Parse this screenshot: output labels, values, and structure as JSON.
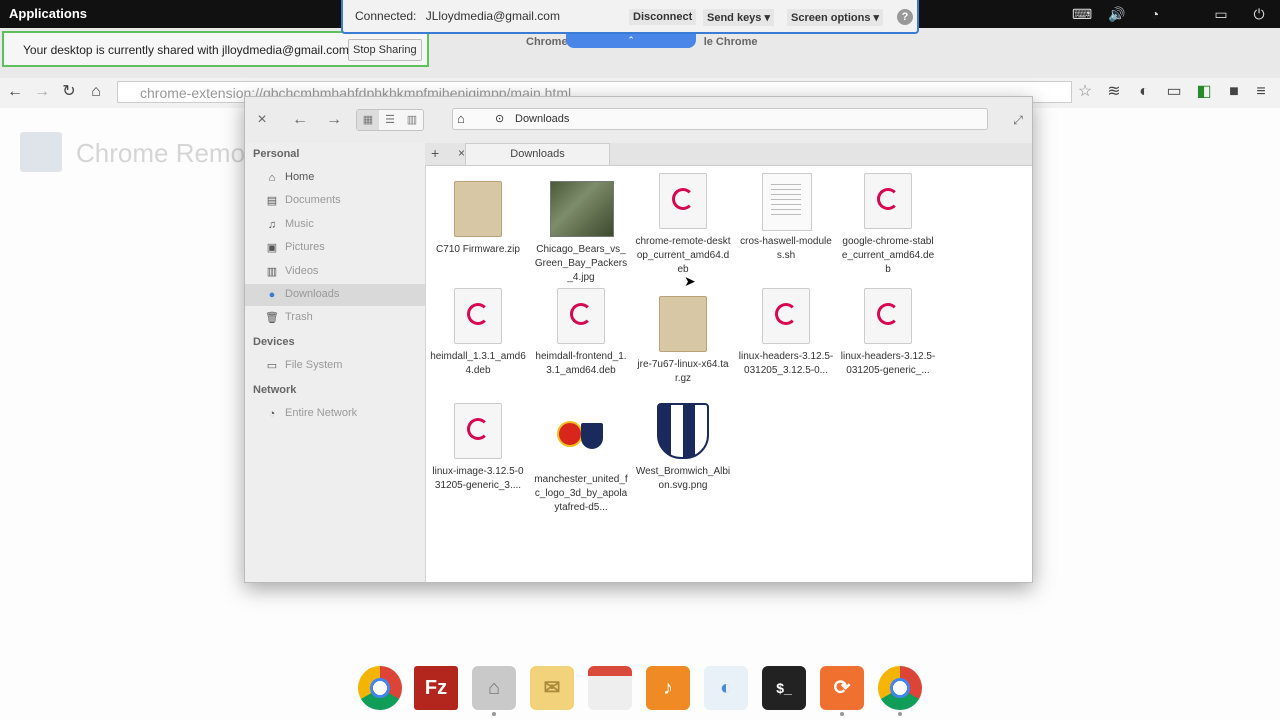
{
  "top_panel": {
    "apps_label": "Applications",
    "tray": [
      "keyboard-icon",
      "volume-icon",
      "wifi-icon",
      "battery-icon",
      "power-icon"
    ]
  },
  "remote": {
    "connected_label": "Connected:",
    "connected_email": "JLloydmedia@gmail.com",
    "disconnect": "Disconnect",
    "send_keys": "Send keys",
    "screen_options": "Screen options",
    "help": "?"
  },
  "chrome": {
    "title_left": "Chrome",
    "title_right": "le Chrome",
    "share_notice": "Your desktop is currently shared with jlloydmedia@gmail.com.",
    "stop_sharing": "Stop Sharing",
    "url": "chrome-extension://gbchcmhmhahfdphkhkmpfmihenigjmpp/main.html",
    "page_title": "Chrome Remo"
  },
  "file_manager": {
    "path": "Downloads",
    "tab": "Downloads",
    "sidebar": {
      "personal": "Personal",
      "devices": "Devices",
      "network": "Network",
      "items": [
        {
          "label": "Home",
          "icon": "home-icon"
        },
        {
          "label": "Documents",
          "icon": "documents-icon"
        },
        {
          "label": "Music",
          "icon": "music-icon"
        },
        {
          "label": "Pictures",
          "icon": "pictures-icon"
        },
        {
          "label": "Videos",
          "icon": "videos-icon"
        },
        {
          "label": "Downloads",
          "icon": "downloads-icon"
        },
        {
          "label": "Trash",
          "icon": "trash-icon"
        },
        {
          "label": "File System",
          "icon": "harddisk-icon"
        },
        {
          "label": "Entire Network",
          "icon": "network-icon"
        }
      ]
    },
    "files": [
      {
        "name": "C710 Firmware.zip",
        "kind": "zip"
      },
      {
        "name": "Chicago_Bears_vs_Green_Bay_Packers_4.jpg",
        "kind": "photo"
      },
      {
        "name": "chrome-remote-desktop_current_amd64.deb",
        "kind": "deb"
      },
      {
        "name": "cros-haswell-modules.sh",
        "kind": "script"
      },
      {
        "name": "google-chrome-stable_current_amd64.deb",
        "kind": "deb"
      },
      {
        "name": "heimdall_1.3.1_amd64.deb",
        "kind": "deb"
      },
      {
        "name": "heimdall-frontend_1.3.1_amd64.deb",
        "kind": "deb"
      },
      {
        "name": "jre-7u67-linux-x64.tar.gz",
        "kind": "zip"
      },
      {
        "name": "linux-headers-3.12.5-031205_3.12.5-0...",
        "kind": "deb"
      },
      {
        "name": "linux-headers-3.12.5-031205-generic_...",
        "kind": "deb"
      },
      {
        "name": "linux-image-3.12.5-031205-generic_3....",
        "kind": "deb"
      },
      {
        "name": "manchester_united_fc_logo_3d_by_apolaytafred-d5...",
        "kind": "logos"
      },
      {
        "name": "West_Bromwich_Albion.svg.png",
        "kind": "shield"
      }
    ]
  },
  "dock": [
    "chrome",
    "filezilla",
    "files",
    "mail",
    "calendar",
    "music",
    "switchboard",
    "terminal",
    "updates",
    "chrome"
  ]
}
